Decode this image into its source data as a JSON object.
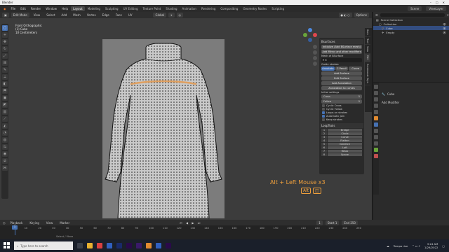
{
  "window": {
    "title": "Blender",
    "controls": [
      "–",
      "□",
      "✕"
    ]
  },
  "menu": {
    "items": [
      "File",
      "Edit",
      "Render",
      "Window",
      "Help"
    ]
  },
  "workspaces": {
    "tabs": [
      "Layout",
      "Modeling",
      "Sculpting",
      "UV Editing",
      "Texture Paint",
      "Shading",
      "Animation",
      "Rendering",
      "Compositing",
      "Geometry Nodes",
      "Scripting"
    ],
    "active": "Layout"
  },
  "top_right": {
    "scene": "Scene",
    "view_layer": "ViewLayer"
  },
  "viewport_header": {
    "mode": "Edit Mode",
    "menus": [
      "View",
      "Select",
      "Add",
      "Mesh",
      "Vertex",
      "Edge",
      "Face",
      "UV"
    ],
    "transform": "Global",
    "options": "Options"
  },
  "viewport_overlay": {
    "view": "Front Orthographic",
    "object": "(1) Cube",
    "scale": "10 Centimeters"
  },
  "npanel": {
    "bsurfaces_header": "Bsurfaces",
    "initialize_btn": "Initialize (Add BSurface mesh)",
    "add_mirror_btn": "Add Mirror and other modifiers",
    "mesh_label": "Mesh of BSurface",
    "guide_strokes_label": "Guide strokes",
    "stroke_modes": [
      "Annotate",
      "C.Pencil",
      "Curve"
    ],
    "add_surface_btn": "Add Surface",
    "edit_surface_btn": "Edit Surface",
    "add_annotation_btn": "Add Annotation",
    "annotation_to_curves_btn": "Annotation to curves",
    "initial_settings_label": "Initial settings",
    "cross_label": "Cross",
    "cross_value": "5",
    "follow_label": "Follow",
    "follow_value": "5",
    "checks": [
      {
        "label": "Cyclic Cross",
        "on": false
      },
      {
        "label": "Cyclic Follow",
        "on": false
      },
      {
        "label": "Loops on strokes",
        "on": true
      },
      {
        "label": "Automatic join",
        "on": true
      },
      {
        "label": "Keep strokes",
        "on": false
      }
    ],
    "looptools_header": "LoopTools",
    "looptools": [
      {
        "n": "1",
        "label": "Bridge"
      },
      {
        "n": "2",
        "label": "Circle"
      },
      {
        "n": "3",
        "label": "Curve"
      },
      {
        "n": "4",
        "label": "Flatten"
      },
      {
        "n": "5",
        "label": "Gstretch"
      },
      {
        "n": "6",
        "label": "Loft"
      },
      {
        "n": "7",
        "label": "Relax"
      },
      {
        "n": "8",
        "label": "Space"
      }
    ]
  },
  "sidebar_tabs": [
    "Item",
    "Tool",
    "View",
    "Edit",
    "Screencast Keys"
  ],
  "outliner": {
    "title": "Scene Collection",
    "rows": [
      {
        "label": "Collection",
        "indent": 1,
        "selected": false
      },
      {
        "label": "Cube",
        "indent": 2,
        "selected": true
      },
      {
        "label": "Empty",
        "indent": 2,
        "selected": false
      }
    ]
  },
  "properties": {
    "object": "Cube",
    "add_modifier": "Add Modifier"
  },
  "hint": {
    "text": "Alt + Left Mouse x3",
    "key": "Alt"
  },
  "timeline": {
    "menus": [
      "Playback",
      "Keying",
      "View",
      "Marker"
    ],
    "current_frame": "1",
    "start_label": "Start",
    "start_value": "1",
    "end_label": "End",
    "end_value": "250",
    "ticks": [
      "10",
      "20",
      "30",
      "40",
      "50",
      "60",
      "70",
      "80",
      "90",
      "100",
      "110",
      "120",
      "130",
      "140",
      "150",
      "160",
      "170",
      "180",
      "190",
      "200",
      "210",
      "220",
      "230",
      "240",
      "250"
    ]
  },
  "status": {
    "text": "Select / Move"
  },
  "taskbar": {
    "search_placeholder": "Type here to search",
    "weather": "Tempo rise",
    "time": "3:24 AM",
    "date": "1/29/2022"
  }
}
